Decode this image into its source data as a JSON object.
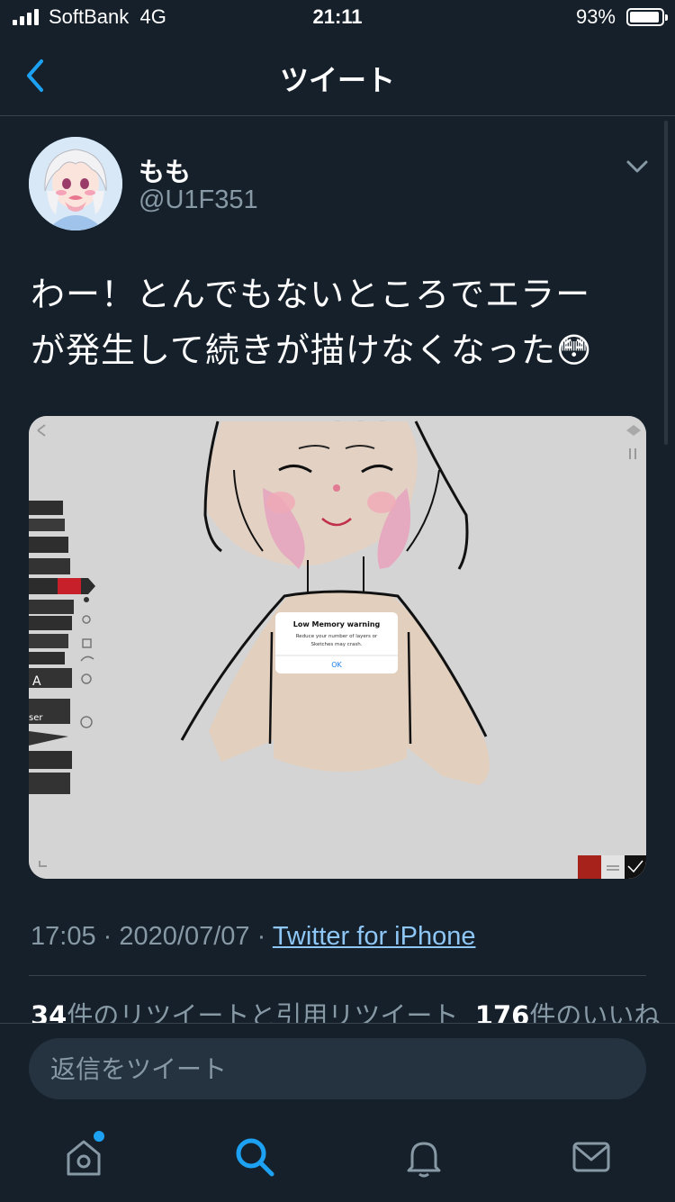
{
  "status_bar": {
    "carrier": "SoftBank",
    "network": "4G",
    "time": "21:11",
    "battery": "93%"
  },
  "nav": {
    "title": "ツイート",
    "back_icon": "chevron-left-icon"
  },
  "tweet": {
    "author_name": "もも",
    "author_handle": "@U1F351",
    "text_line1": "わー！とんでもないところでエラー",
    "text_line2": "が発生して続きが描けなくなった😳",
    "image": {
      "dialog_title": "Low Memory warning",
      "dialog_message_line1": "Reduce your number of layers or",
      "dialog_message_line2": "Sketches may crash.",
      "dialog_button": "OK",
      "eraser_label": "ser",
      "text_tool_label": "A"
    },
    "time": "17:05",
    "date": "2020/07/07",
    "separator": "·",
    "source": "Twitter for iPhone",
    "retweet_count": "34",
    "retweet_label": "件のリツイートと引用リツイート",
    "like_count": "176",
    "like_label": "件のいいね"
  },
  "reply": {
    "placeholder": "返信をツイート"
  },
  "tab_bar": {
    "items": [
      "home-icon",
      "search-icon",
      "notifications-icon",
      "messages-icon"
    ],
    "accent": "#1da1f2",
    "inactive": "#8899a6"
  },
  "colors": {
    "background": "#15202b",
    "divider": "#38444d",
    "accent": "#1da1f2",
    "secondary_text": "#8899a6"
  }
}
